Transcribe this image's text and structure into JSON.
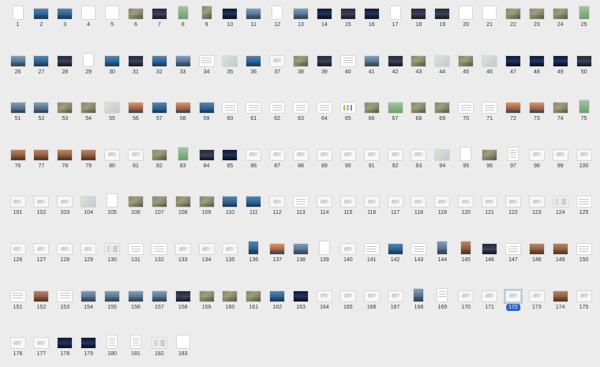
{
  "app": {
    "view": "page-thumbnails",
    "selected_page": 172,
    "accent_color": "#2a64c5",
    "background_color": "#ececec"
  },
  "thumbnails": [
    {
      "page": "1",
      "style": "white",
      "ar": "portrait"
    },
    {
      "page": "2",
      "style": "blue",
      "ar": "landscape"
    },
    {
      "page": "3",
      "style": "blue",
      "ar": "landscape"
    },
    {
      "page": "4",
      "style": "white",
      "ar": "square"
    },
    {
      "page": "5",
      "style": "white",
      "ar": "square"
    },
    {
      "page": "6",
      "style": "aerial",
      "ar": "landscape"
    },
    {
      "page": "7",
      "style": "dark",
      "ar": "landscape"
    },
    {
      "page": "8",
      "style": "green",
      "ar": "portrait"
    },
    {
      "page": "9",
      "style": "aerial",
      "ar": "portrait"
    },
    {
      "page": "10",
      "style": "night",
      "ar": "landscape"
    },
    {
      "page": "11",
      "style": "city",
      "ar": "landscape"
    },
    {
      "page": "12",
      "style": "white",
      "ar": "portrait"
    },
    {
      "page": "13",
      "style": "city",
      "ar": "landscape"
    },
    {
      "page": "14",
      "style": "night",
      "ar": "landscape"
    },
    {
      "page": "15",
      "style": "dark",
      "ar": "landscape"
    },
    {
      "page": "16",
      "style": "night",
      "ar": "landscape"
    },
    {
      "page": "17",
      "style": "white",
      "ar": "portrait"
    },
    {
      "page": "18",
      "style": "dark",
      "ar": "landscape"
    },
    {
      "page": "19",
      "style": "dark",
      "ar": "landscape"
    },
    {
      "page": "20",
      "style": "white",
      "ar": "square"
    },
    {
      "page": "21",
      "style": "white",
      "ar": "square"
    },
    {
      "page": "22",
      "style": "aerial",
      "ar": "landscape"
    },
    {
      "page": "23",
      "style": "aerial",
      "ar": "landscape"
    },
    {
      "page": "24",
      "style": "aerial",
      "ar": "landscape"
    },
    {
      "page": "25",
      "style": "green",
      "ar": "portrait"
    },
    {
      "page": "26",
      "style": "city",
      "ar": "landscape"
    },
    {
      "page": "27",
      "style": "blue",
      "ar": "landscape"
    },
    {
      "page": "28",
      "style": "dark",
      "ar": "landscape"
    },
    {
      "page": "29",
      "style": "white",
      "ar": "portrait"
    },
    {
      "page": "30",
      "style": "blue",
      "ar": "landscape"
    },
    {
      "page": "31",
      "style": "dark",
      "ar": "landscape"
    },
    {
      "page": "32",
      "style": "blue",
      "ar": "landscape"
    },
    {
      "page": "33",
      "style": "city",
      "ar": "landscape"
    },
    {
      "page": "34",
      "style": "doc",
      "ar": "landscape"
    },
    {
      "page": "35",
      "style": "map",
      "ar": "landscape"
    },
    {
      "page": "36",
      "style": "blue",
      "ar": "landscape"
    },
    {
      "page": "37",
      "style": "diag",
      "ar": "landscape"
    },
    {
      "page": "38",
      "style": "aerial",
      "ar": "landscape"
    },
    {
      "page": "39",
      "style": "dark",
      "ar": "landscape"
    },
    {
      "page": "40",
      "style": "doc",
      "ar": "landscape"
    },
    {
      "page": "41",
      "style": "city",
      "ar": "landscape"
    },
    {
      "page": "42",
      "style": "dark",
      "ar": "landscape"
    },
    {
      "page": "43",
      "style": "aerial",
      "ar": "landscape"
    },
    {
      "page": "44",
      "style": "map",
      "ar": "landscape"
    },
    {
      "page": "45",
      "style": "aerial",
      "ar": "landscape"
    },
    {
      "page": "46",
      "style": "map",
      "ar": "landscape"
    },
    {
      "page": "47",
      "style": "night",
      "ar": "landscape"
    },
    {
      "page": "48",
      "style": "night",
      "ar": "landscape"
    },
    {
      "page": "49",
      "style": "night",
      "ar": "landscape"
    },
    {
      "page": "50",
      "style": "dark",
      "ar": "landscape"
    },
    {
      "page": "51",
      "style": "city",
      "ar": "landscape"
    },
    {
      "page": "52",
      "style": "city",
      "ar": "landscape"
    },
    {
      "page": "53",
      "style": "aerial",
      "ar": "landscape"
    },
    {
      "page": "54",
      "style": "aerial",
      "ar": "landscape"
    },
    {
      "page": "55",
      "style": "map",
      "ar": "landscape"
    },
    {
      "page": "56",
      "style": "sunset",
      "ar": "landscape"
    },
    {
      "page": "57",
      "style": "blue",
      "ar": "landscape"
    },
    {
      "page": "58",
      "style": "sunset",
      "ar": "landscape"
    },
    {
      "page": "59",
      "style": "blue",
      "ar": "landscape"
    },
    {
      "page": "60",
      "style": "doc",
      "ar": "landscape"
    },
    {
      "page": "61",
      "style": "doc",
      "ar": "landscape"
    },
    {
      "page": "62",
      "style": "doc",
      "ar": "landscape"
    },
    {
      "page": "63",
      "style": "doc",
      "ar": "landscape"
    },
    {
      "page": "64",
      "style": "doc",
      "ar": "landscape"
    },
    {
      "page": "65",
      "style": "chart",
      "ar": "landscape"
    },
    {
      "page": "66",
      "style": "aerial",
      "ar": "landscape"
    },
    {
      "page": "67",
      "style": "green",
      "ar": "landscape"
    },
    {
      "page": "68",
      "style": "aerial",
      "ar": "landscape"
    },
    {
      "page": "69",
      "style": "aerial",
      "ar": "landscape"
    },
    {
      "page": "70",
      "style": "doc",
      "ar": "landscape"
    },
    {
      "page": "71",
      "style": "doc",
      "ar": "landscape"
    },
    {
      "page": "72",
      "style": "sunset",
      "ar": "landscape"
    },
    {
      "page": "73",
      "style": "sunset",
      "ar": "landscape"
    },
    {
      "page": "74",
      "style": "aerial",
      "ar": "landscape"
    },
    {
      "page": "75",
      "style": "green",
      "ar": "portrait"
    },
    {
      "page": "76",
      "style": "brown",
      "ar": "landscape"
    },
    {
      "page": "77",
      "style": "brown",
      "ar": "landscape"
    },
    {
      "page": "78",
      "style": "brown",
      "ar": "landscape"
    },
    {
      "page": "79",
      "style": "brown",
      "ar": "landscape"
    },
    {
      "page": "80",
      "style": "diag",
      "ar": "landscape"
    },
    {
      "page": "81",
      "style": "diag",
      "ar": "landscape"
    },
    {
      "page": "82",
      "style": "aerial",
      "ar": "landscape"
    },
    {
      "page": "83",
      "style": "green",
      "ar": "portrait"
    },
    {
      "page": "84",
      "style": "dark",
      "ar": "landscape"
    },
    {
      "page": "85",
      "style": "night",
      "ar": "landscape"
    },
    {
      "page": "86",
      "style": "diag",
      "ar": "landscape"
    },
    {
      "page": "87",
      "style": "diag",
      "ar": "landscape"
    },
    {
      "page": "88",
      "style": "diag",
      "ar": "landscape"
    },
    {
      "page": "89",
      "style": "diag",
      "ar": "landscape"
    },
    {
      "page": "90",
      "style": "diag",
      "ar": "landscape"
    },
    {
      "page": "91",
      "style": "diag",
      "ar": "landscape"
    },
    {
      "page": "92",
      "style": "diag",
      "ar": "landscape"
    },
    {
      "page": "93",
      "style": "diag",
      "ar": "landscape"
    },
    {
      "page": "94",
      "style": "map",
      "ar": "landscape"
    },
    {
      "page": "95",
      "style": "white",
      "ar": "portrait"
    },
    {
      "page": "96",
      "style": "aerial",
      "ar": "landscape"
    },
    {
      "page": "97",
      "style": "doc",
      "ar": "portrait"
    },
    {
      "page": "98",
      "style": "diag",
      "ar": "landscape"
    },
    {
      "page": "99",
      "style": "diag",
      "ar": "landscape"
    },
    {
      "page": "100",
      "style": "diag",
      "ar": "landscape"
    },
    {
      "page": "101",
      "style": "diag",
      "ar": "landscape"
    },
    {
      "page": "102",
      "style": "diag",
      "ar": "landscape"
    },
    {
      "page": "103",
      "style": "diag",
      "ar": "landscape"
    },
    {
      "page": "104",
      "style": "map",
      "ar": "landscape"
    },
    {
      "page": "105",
      "style": "white",
      "ar": "portrait"
    },
    {
      "page": "106",
      "style": "aerial",
      "ar": "landscape"
    },
    {
      "page": "107",
      "style": "aerial",
      "ar": "landscape"
    },
    {
      "page": "108",
      "style": "aerial",
      "ar": "landscape"
    },
    {
      "page": "109",
      "style": "aerial",
      "ar": "landscape"
    },
    {
      "page": "110",
      "style": "blue",
      "ar": "landscape"
    },
    {
      "page": "111",
      "style": "blue",
      "ar": "landscape"
    },
    {
      "page": "112",
      "style": "diag",
      "ar": "landscape"
    },
    {
      "page": "113",
      "style": "doc",
      "ar": "landscape"
    },
    {
      "page": "114",
      "style": "diag",
      "ar": "landscape"
    },
    {
      "page": "115",
      "style": "diag",
      "ar": "landscape"
    },
    {
      "page": "116",
      "style": "diag",
      "ar": "landscape"
    },
    {
      "page": "117",
      "style": "diag",
      "ar": "landscape"
    },
    {
      "page": "118",
      "style": "diag",
      "ar": "landscape"
    },
    {
      "page": "119",
      "style": "diag",
      "ar": "landscape"
    },
    {
      "page": "120",
      "style": "diag",
      "ar": "landscape"
    },
    {
      "page": "121",
      "style": "diag",
      "ar": "landscape"
    },
    {
      "page": "122",
      "style": "diag",
      "ar": "landscape"
    },
    {
      "page": "123",
      "style": "diag",
      "ar": "landscape"
    },
    {
      "page": "124",
      "style": "plan",
      "ar": "landscape"
    },
    {
      "page": "125",
      "style": "doc",
      "ar": "landscape"
    },
    {
      "page": "126",
      "style": "diag",
      "ar": "landscape"
    },
    {
      "page": "127",
      "style": "diag",
      "ar": "landscape"
    },
    {
      "page": "128",
      "style": "diag",
      "ar": "landscape"
    },
    {
      "page": "129",
      "style": "diag",
      "ar": "landscape"
    },
    {
      "page": "130",
      "style": "plan",
      "ar": "landscape"
    },
    {
      "page": "131",
      "style": "doc",
      "ar": "landscape"
    },
    {
      "page": "132",
      "style": "doc",
      "ar": "landscape"
    },
    {
      "page": "133",
      "style": "diag",
      "ar": "landscape"
    },
    {
      "page": "134",
      "style": "diag",
      "ar": "landscape"
    },
    {
      "page": "135",
      "style": "diag",
      "ar": "landscape"
    },
    {
      "page": "136",
      "style": "blue",
      "ar": "portrait"
    },
    {
      "page": "137",
      "style": "sunset",
      "ar": "landscape"
    },
    {
      "page": "138",
      "style": "city",
      "ar": "landscape"
    },
    {
      "page": "139",
      "style": "white",
      "ar": "portrait"
    },
    {
      "page": "140",
      "style": "diag",
      "ar": "landscape"
    },
    {
      "page": "141",
      "style": "doc",
      "ar": "landscape"
    },
    {
      "page": "142",
      "style": "blue",
      "ar": "landscape"
    },
    {
      "page": "143",
      "style": "doc",
      "ar": "landscape"
    },
    {
      "page": "144",
      "style": "city",
      "ar": "portrait"
    },
    {
      "page": "145",
      "style": "brown",
      "ar": "portrait"
    },
    {
      "page": "146",
      "style": "dark",
      "ar": "landscape"
    },
    {
      "page": "147",
      "style": "doc",
      "ar": "landscape"
    },
    {
      "page": "148",
      "style": "brown",
      "ar": "landscape"
    },
    {
      "page": "149",
      "style": "brown",
      "ar": "landscape"
    },
    {
      "page": "150",
      "style": "doc",
      "ar": "landscape"
    },
    {
      "page": "151",
      "style": "doc",
      "ar": "landscape"
    },
    {
      "page": "152",
      "style": "brown",
      "ar": "landscape"
    },
    {
      "page": "153",
      "style": "doc",
      "ar": "landscape"
    },
    {
      "page": "154",
      "style": "city",
      "ar": "landscape"
    },
    {
      "page": "155",
      "style": "city",
      "ar": "landscape"
    },
    {
      "page": "156",
      "style": "city",
      "ar": "landscape"
    },
    {
      "page": "157",
      "style": "city",
      "ar": "landscape"
    },
    {
      "page": "158",
      "style": "dark",
      "ar": "landscape"
    },
    {
      "page": "159",
      "style": "aerial",
      "ar": "landscape"
    },
    {
      "page": "160",
      "style": "aerial",
      "ar": "landscape"
    },
    {
      "page": "161",
      "style": "aerial",
      "ar": "landscape"
    },
    {
      "page": "162",
      "style": "blue",
      "ar": "landscape"
    },
    {
      "page": "163",
      "style": "night",
      "ar": "landscape"
    },
    {
      "page": "164",
      "style": "diag",
      "ar": "landscape"
    },
    {
      "page": "165",
      "style": "diag",
      "ar": "landscape"
    },
    {
      "page": "166",
      "style": "diag",
      "ar": "landscape"
    },
    {
      "page": "167",
      "style": "diag",
      "ar": "landscape"
    },
    {
      "page": "168",
      "style": "city",
      "ar": "portrait"
    },
    {
      "page": "169",
      "style": "doc",
      "ar": "portrait"
    },
    {
      "page": "170",
      "style": "diag",
      "ar": "landscape"
    },
    {
      "page": "171",
      "style": "diag",
      "ar": "landscape"
    },
    {
      "page": "172",
      "style": "diag",
      "ar": "landscape",
      "selected": true
    },
    {
      "page": "173",
      "style": "diag",
      "ar": "landscape"
    },
    {
      "page": "174",
      "style": "brown",
      "ar": "landscape"
    },
    {
      "page": "175",
      "style": "diag",
      "ar": "landscape"
    },
    {
      "page": "176",
      "style": "diag",
      "ar": "landscape"
    },
    {
      "page": "177",
      "style": "diag",
      "ar": "landscape"
    },
    {
      "page": "178",
      "style": "night",
      "ar": "landscape"
    },
    {
      "page": "179",
      "style": "night",
      "ar": "landscape"
    },
    {
      "page": "180",
      "style": "doc",
      "ar": "portrait"
    },
    {
      "page": "181",
      "style": "doc",
      "ar": "portrait"
    },
    {
      "page": "182",
      "style": "plan",
      "ar": "landscape"
    },
    {
      "page": "183",
      "style": "white",
      "ar": "square"
    }
  ]
}
